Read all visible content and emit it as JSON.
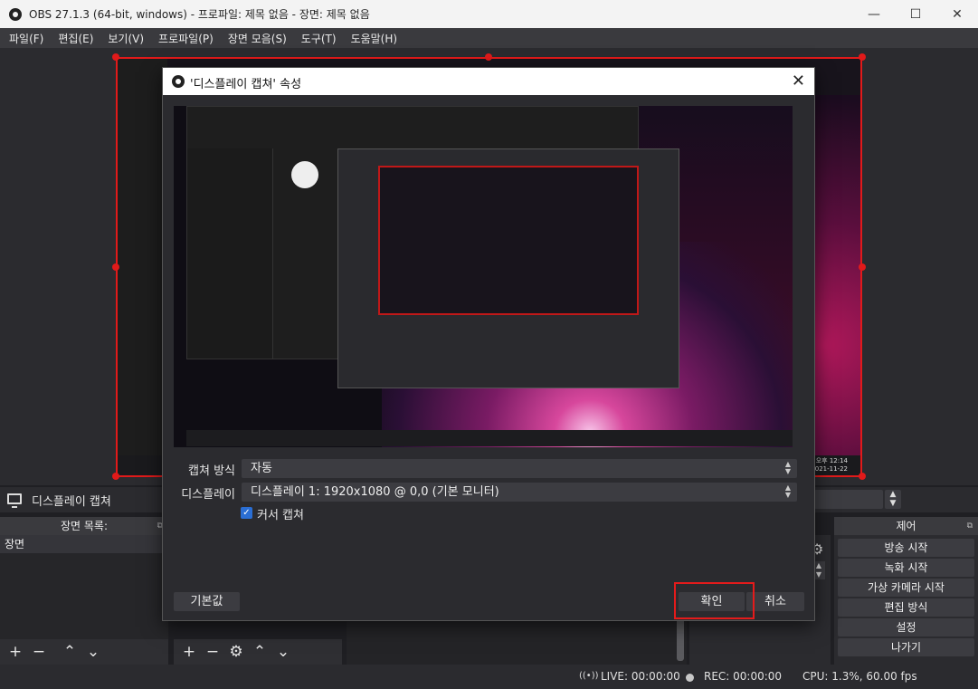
{
  "window": {
    "title": "OBS 27.1.3 (64-bit, windows) - 프로파일: 제목 없음 - 장면: 제목 없음",
    "minimize_glyph": "—",
    "maximize_glyph": "☐",
    "close_glyph": "✕"
  },
  "menu": [
    "파일(F)",
    "편집(E)",
    "보기(V)",
    "프로파일(P)",
    "장면 모음(S)",
    "도구(T)",
    "도움말(H)"
  ],
  "preview": {
    "clock_time": "오후 12:14",
    "clock_date": "2021-11-22"
  },
  "source_bar": {
    "label": "디스플레이 캡쳐"
  },
  "scenes": {
    "title": "장면 목록:",
    "items": [
      "장면"
    ]
  },
  "controls": {
    "title": "제어",
    "buttons": [
      "방송 시작",
      "녹화 시작",
      "가상 카메라 시작",
      "편집 방식",
      "설정",
      "나가기"
    ]
  },
  "status": {
    "live": "LIVE: 00:00:00",
    "rec": "REC: 00:00:00",
    "cpu": "CPU: 1.3%, 60.00 fps"
  },
  "dialog": {
    "title": "'디스플레이 캡쳐' 속성",
    "capture_method_label": "캡쳐 방식",
    "capture_method_value": "자동",
    "display_label": "디스플레이",
    "display_value": "디스플레이 1: 1920x1080 @ 0,0 (기본 모니터)",
    "capture_cursor_label": "커서 캡쳐",
    "capture_cursor_checked": true,
    "defaults_button": "기본값",
    "ok_button": "확인",
    "cancel_button": "취소"
  },
  "colors": {
    "accent_red": "#e11a1a",
    "checkbox_blue": "#2a6ed4"
  }
}
